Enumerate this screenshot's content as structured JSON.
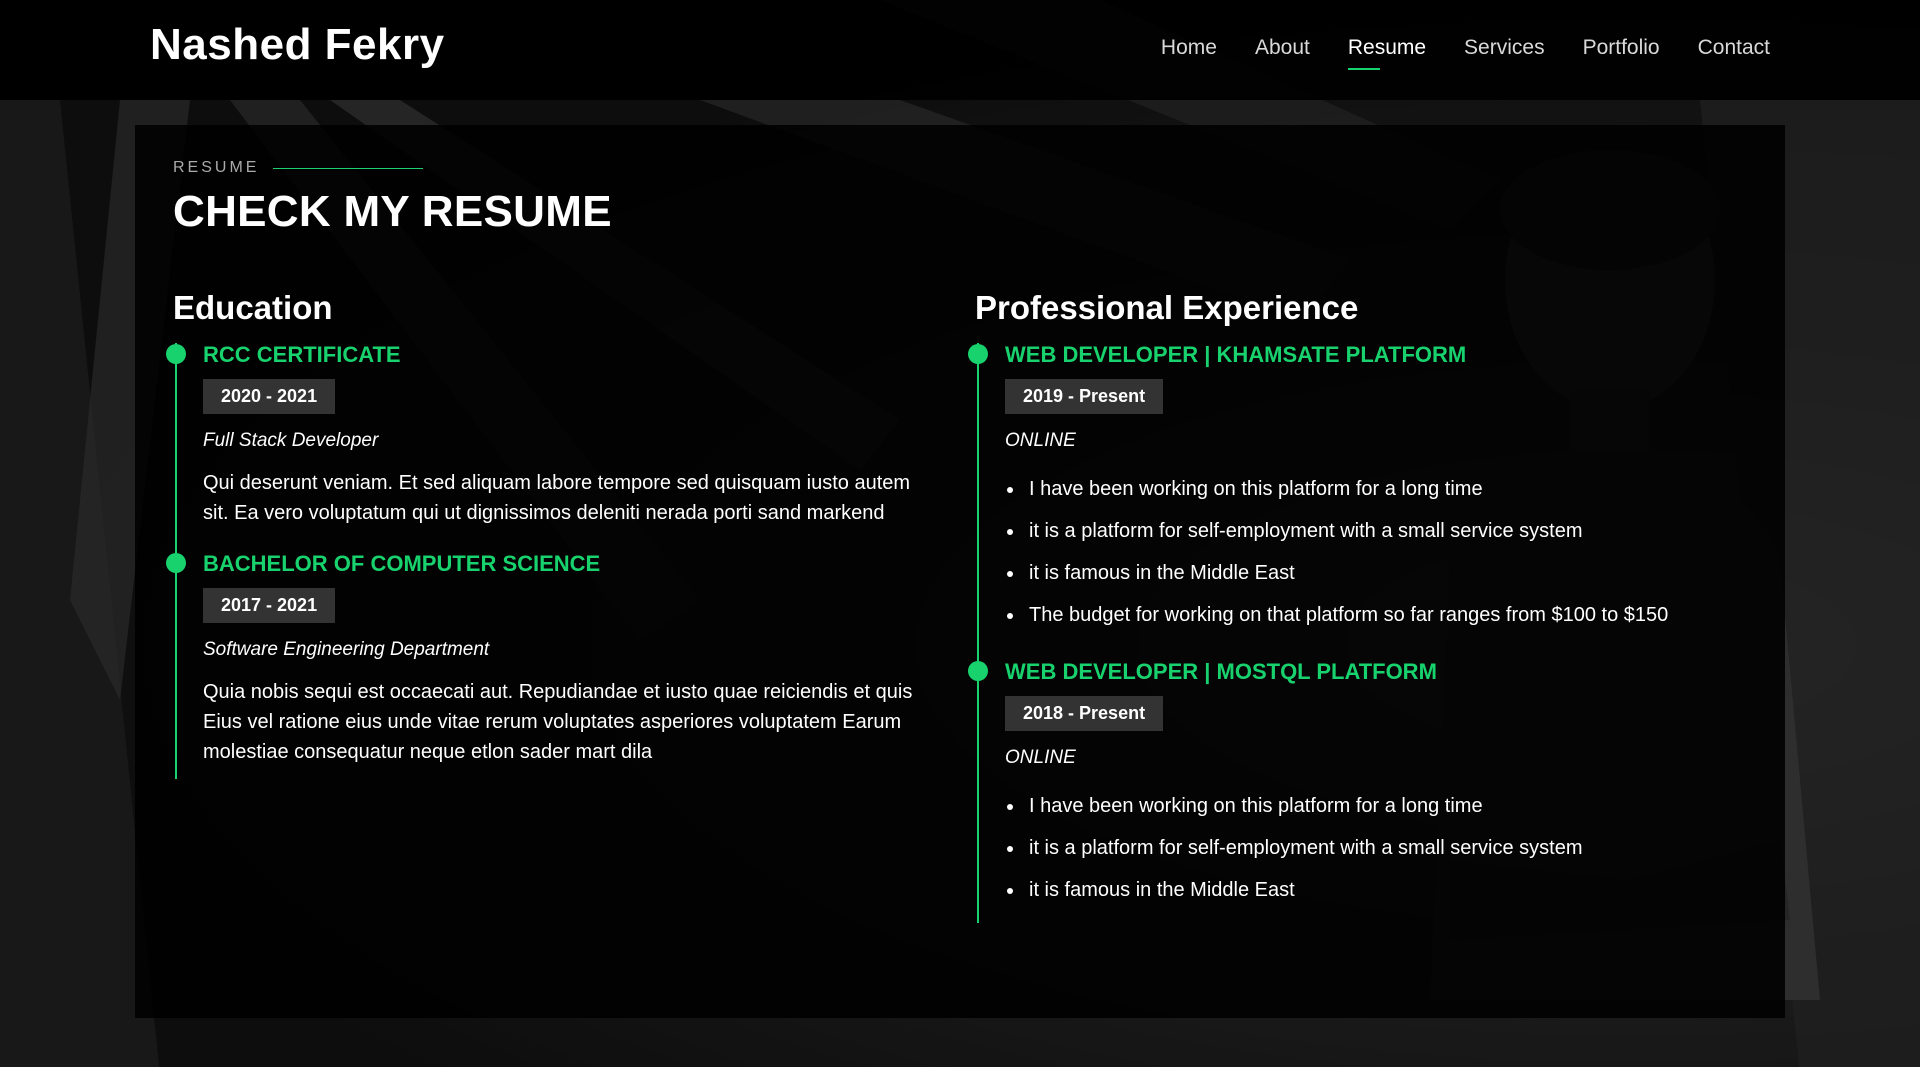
{
  "header": {
    "logo": "Nashed Fekry",
    "nav": [
      {
        "label": "Home",
        "active": false
      },
      {
        "label": "About",
        "active": false
      },
      {
        "label": "Resume",
        "active": true
      },
      {
        "label": "Services",
        "active": false
      },
      {
        "label": "Portfolio",
        "active": false
      },
      {
        "label": "Contact",
        "active": false
      }
    ]
  },
  "resume": {
    "tag": "RESUME",
    "title": "CHECK MY RESUME",
    "education": {
      "heading": "Education",
      "items": [
        {
          "title": "RCC CERTIFICATE",
          "dates": "2020 - 2021",
          "subtitle": "Full Stack Developer",
          "text": "Qui deserunt veniam. Et sed aliquam labore tempore sed quisquam iusto autem sit. Ea vero voluptatum qui ut dignissimos deleniti nerada porti sand markend"
        },
        {
          "title": "BACHELOR OF COMPUTER SCIENCE",
          "dates": "2017 - 2021",
          "subtitle": "Software Engineering Department",
          "text": "Quia nobis sequi est occaecati aut. Repudiandae et iusto quae reiciendis et quis Eius vel ratione eius unde vitae rerum voluptates asperiores voluptatem Earum molestiae consequatur neque etlon sader mart dila"
        }
      ]
    },
    "experience": {
      "heading": "Professional Experience",
      "items": [
        {
          "title": "WEB DEVELOPER | KHAMSATE PLATFORM",
          "dates": "2019 - Present",
          "subtitle": "ONLINE",
          "bullets": [
            "I have been working on this platform for a long time",
            "it is a platform for self-employment with a small service system",
            "it is famous in the Middle East",
            "The budget for working on that platform so far ranges from $100 to $150"
          ]
        },
        {
          "title": "WEB DEVELOPER | MOSTQL PLATFORM",
          "dates": "2018 - Present",
          "subtitle": "ONLINE",
          "bullets": [
            "I have been working on this platform for a long time",
            "it is a platform for self-employment with a small service system",
            "it is famous in the Middle East"
          ]
        }
      ]
    }
  },
  "colors": {
    "accent": "#18d26e",
    "badge_bg": "#333333",
    "panel_bg": "#000000"
  }
}
